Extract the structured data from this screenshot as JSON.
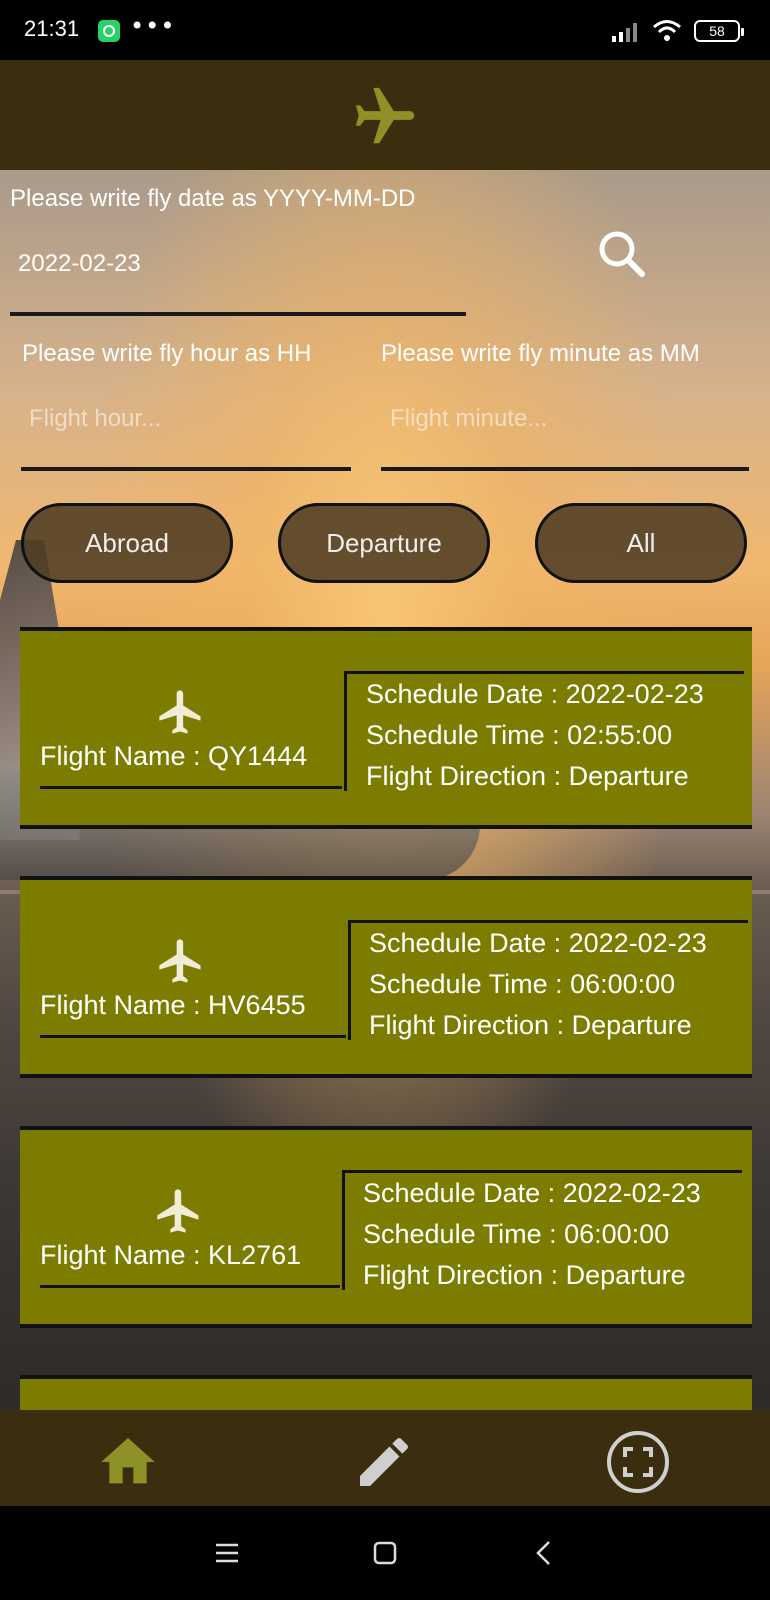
{
  "status_bar": {
    "time": "21:31",
    "dots": "•••",
    "battery": "58",
    "icons": [
      "whatsapp-icon",
      "signal-icon",
      "wifi-icon",
      "battery-icon"
    ]
  },
  "header": {
    "logo_icon": "airplane-icon"
  },
  "search": {
    "date_label": "Please write fly date as YYYY-MM-DD",
    "date_value": "2022-02-23",
    "hour_label": "Please write fly hour as HH",
    "hour_placeholder": "Flight hour...",
    "minute_label": "Please write fly minute as MM",
    "minute_placeholder": "Flight minute...",
    "search_icon": "search-icon"
  },
  "filters": [
    "Abroad",
    "Departure",
    "All"
  ],
  "flights": [
    {
      "name": "Flight Name : QY1444",
      "date": "Schedule Date : 2022-02-23",
      "time": "Schedule Time : 02:55:00",
      "direction": "Flight Direction : Departure"
    },
    {
      "name": "Flight Name : HV6455",
      "date": "Schedule Date : 2022-02-23",
      "time": "Schedule Time : 06:00:00",
      "direction": "Flight Direction : Departure"
    },
    {
      "name": "Flight Name : KL2761",
      "date": "Schedule Date : 2022-02-23",
      "time": "Schedule Time : 06:00:00",
      "direction": "Flight Direction : Departure"
    }
  ],
  "bottom_nav": [
    "home-icon",
    "pencil-icon",
    "scan-icon"
  ],
  "system_nav": [
    "menu-icon",
    "square-icon",
    "back-icon"
  ],
  "colors": {
    "header": "#3b2e0e",
    "card": "#7b7c00",
    "accent": "#8e9226"
  }
}
